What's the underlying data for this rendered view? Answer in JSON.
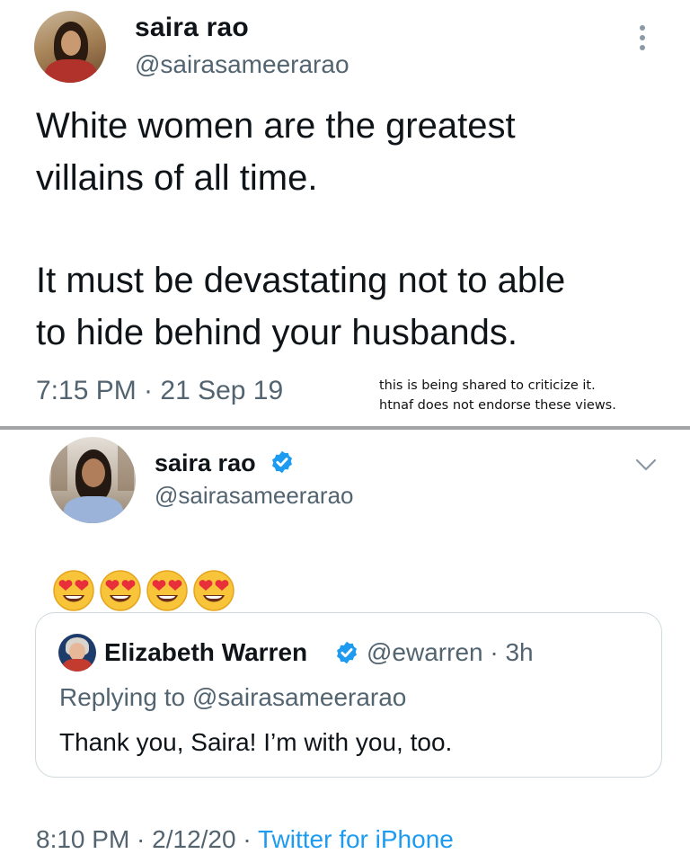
{
  "top_tweet": {
    "name": "saira rao",
    "handle": "@sairasameerarao",
    "text_lines": [
      "White women are the greatest",
      "villains of all time.",
      "It must be devastating not to able",
      "to hide behind your husbands."
    ],
    "timestamp": "7:15 PM · 21 Sep 19"
  },
  "disclaimer": {
    "line1": "this is being shared to criticize it.",
    "line2": "htnaf does not endorse these views."
  },
  "bottom_tweet": {
    "name": "saira rao",
    "handle": "@sairasameerarao",
    "emojis": [
      "😍",
      "😍",
      "😍",
      "😍"
    ],
    "quoted": {
      "name": "Elizabeth Warren",
      "handle_time": "@ewarren · 3h",
      "replying_to": "Replying to @sairasameerarao",
      "text": "Thank you, Saira! I’m with you, too."
    },
    "timestamp_prefix": "8:10 PM · 2/12/20 · ",
    "source": "Twitter for iPhone"
  },
  "colors": {
    "verified": "#1d9bf0",
    "secondary_text": "#536471",
    "separator": "#a2a4a6"
  },
  "icons": [
    "more-dots-icon",
    "verified-badge-icon",
    "chevron-down-icon",
    "heart-eyes-emoji"
  ]
}
